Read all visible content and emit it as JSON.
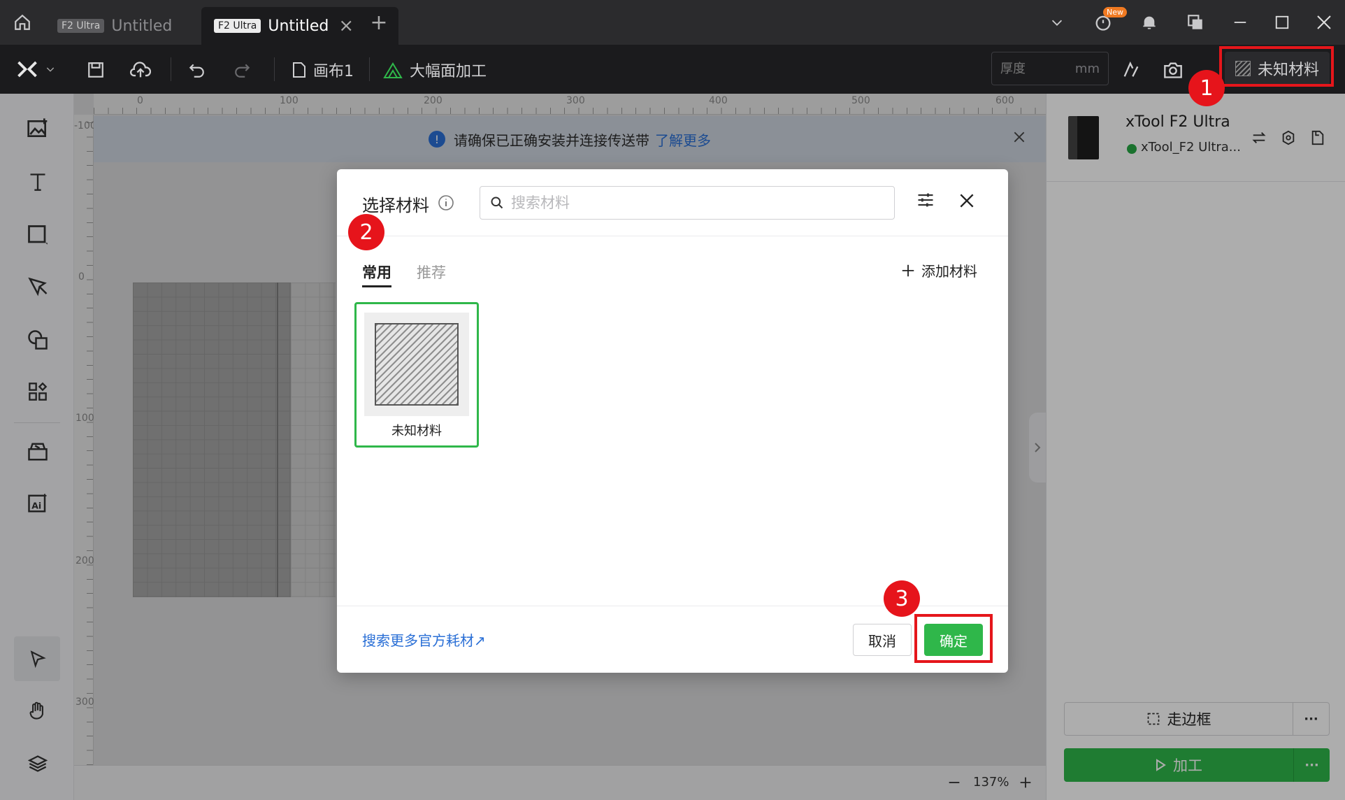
{
  "titlebar": {
    "tabs": [
      {
        "tag": "F2 Ultra",
        "title": "Untitled",
        "active": false
      },
      {
        "tag": "F2 Ultra",
        "title": "Untitled",
        "active": true
      }
    ],
    "new_badge": "New",
    "close_tab": "×",
    "add_tab": "+"
  },
  "toolbar": {
    "canvas_label": "画布1",
    "mode_label": "大幅面加工",
    "thickness_placeholder": "厚度",
    "thickness_unit": "mm",
    "material_label": "未知材料"
  },
  "ruler": {
    "top_ticks": [
      "0",
      "100",
      "200",
      "300",
      "400",
      "500",
      "600"
    ],
    "left_ticks": [
      "-100",
      "0",
      "100",
      "200",
      "300"
    ]
  },
  "notice": {
    "text": "请确保已正确安装并连接传送带",
    "link": "了解更多"
  },
  "device": {
    "name": "xTool F2 Ultra",
    "status": "xTool_F2 Ultra..."
  },
  "actions": {
    "frame_label": "走边框",
    "process_label": "加工",
    "more": "···"
  },
  "zoom": {
    "level": "137%"
  },
  "modal": {
    "title": "选择材料",
    "search_placeholder": "搜索材料",
    "tabs": [
      {
        "label": "常用",
        "active": true
      },
      {
        "label": "推荐",
        "active": false
      }
    ],
    "add_material": "添加材料",
    "items": [
      {
        "label": "未知材料",
        "selected": true
      }
    ],
    "more_link": "搜索更多官方耗材↗",
    "cancel": "取消",
    "confirm": "确定"
  },
  "annotations": [
    "1",
    "2",
    "3"
  ],
  "colors": {
    "accent_green": "#2fb74a",
    "highlight_red": "#e5161b",
    "link_blue": "#2a6fd6",
    "titlebar_dark": "#2b2b2d",
    "toolbar_dark": "#1b1b1d"
  }
}
